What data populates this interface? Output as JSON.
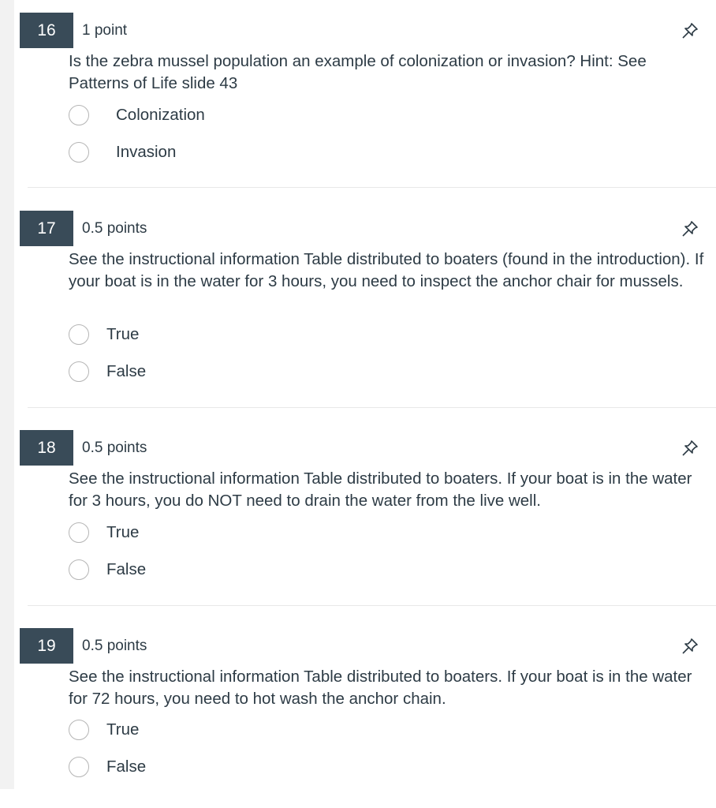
{
  "questions": [
    {
      "number": "16",
      "points": "1 point",
      "text": "Is the zebra mussel population an example of colonization or invasion?  Hint: See Patterns of Life slide 43",
      "answers": [
        "Colonization",
        "Invasion"
      ]
    },
    {
      "number": "17",
      "points": "0.5 points",
      "text": "See the instructional information Table distributed to boaters (found in the introduction).  If your boat is in the water for 3 hours, you need to inspect the anchor chair for mussels.",
      "answers": [
        "True",
        "False"
      ]
    },
    {
      "number": "18",
      "points": "0.5 points",
      "text": "See the instructional information Table distributed to boaters.  If your boat is in the water for 3 hours, you do NOT need to drain the water from the live well.",
      "answers": [
        "True",
        "False"
      ]
    },
    {
      "number": "19",
      "points": "0.5 points",
      "text": "See the instructional information Table distributed to boaters.  If your boat is in the water for 72 hours, you need to hot wash the anchor chain.",
      "answers": [
        "True",
        "False"
      ]
    }
  ],
  "icons": {
    "pin": "pin-icon",
    "radio": "radio-button"
  },
  "colors": {
    "number_badge_bg": "#394b58",
    "text": "#2d3b45",
    "radio_border": "#b5b5b5"
  }
}
